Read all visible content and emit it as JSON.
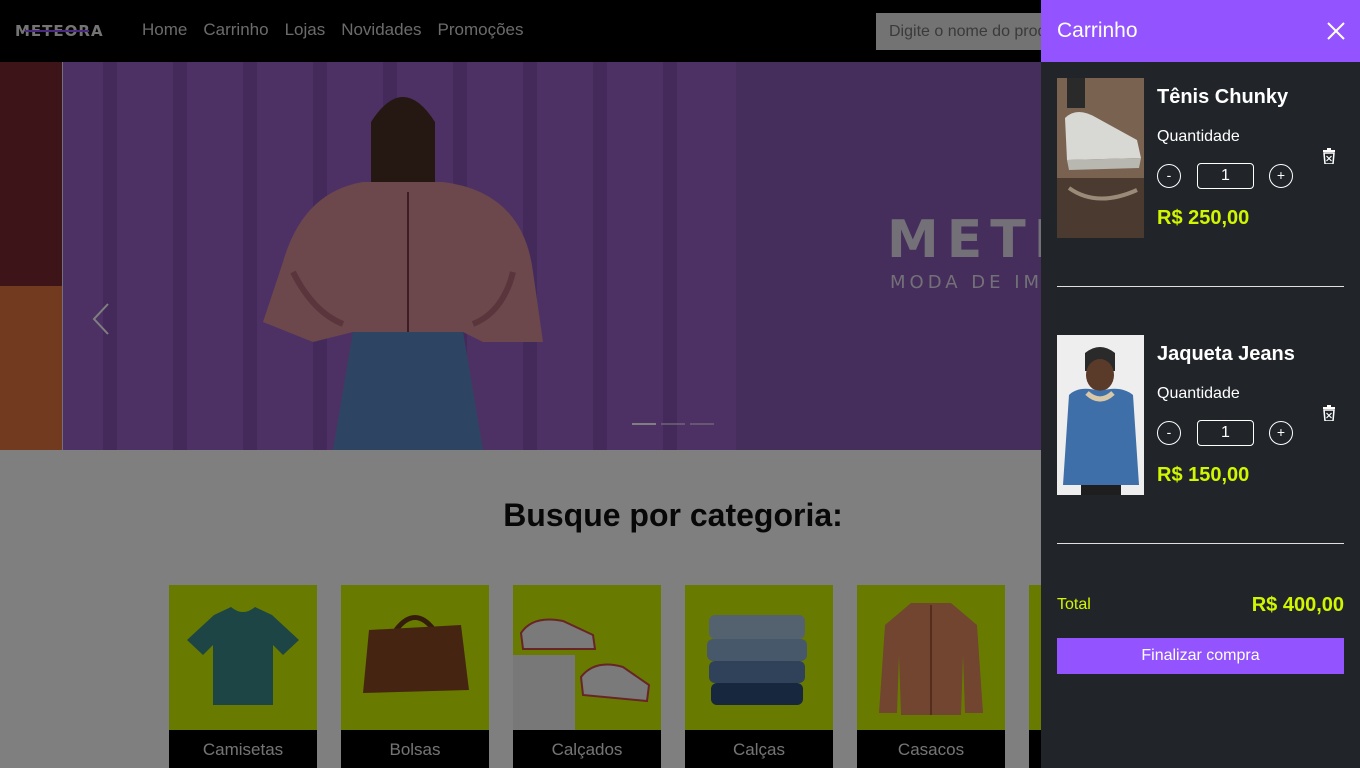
{
  "header": {
    "logo": "METEORA",
    "nav": [
      "Home",
      "Carrinho",
      "Lojas",
      "Novidades",
      "Promoções"
    ],
    "search_placeholder": "Digite o nome do produto"
  },
  "hero": {
    "brand": "METEORA",
    "tagline": "MODA DE IMPACTO",
    "slide_count": 3,
    "active_slide": 1
  },
  "categories": {
    "title": "Busque por categoria:",
    "items": [
      "Camisetas",
      "Bolsas",
      "Calçados",
      "Calças",
      "Casacos"
    ]
  },
  "cart": {
    "title": "Carrinho",
    "quantity_label": "Quantidade",
    "items": [
      {
        "name": "Tênis Chunky",
        "quantity": "1",
        "price": "R$ 250,00"
      },
      {
        "name": "Jaqueta Jeans",
        "quantity": "1",
        "price": "R$ 150,00"
      }
    ],
    "total_label": "Total",
    "total_value": "R$ 400,00",
    "checkout_label": "Finalizar compra"
  },
  "colors": {
    "accent": "#9353ff",
    "highlight": "#d0f600",
    "panel_bg": "#212529",
    "navbar_bg": "#000000"
  }
}
